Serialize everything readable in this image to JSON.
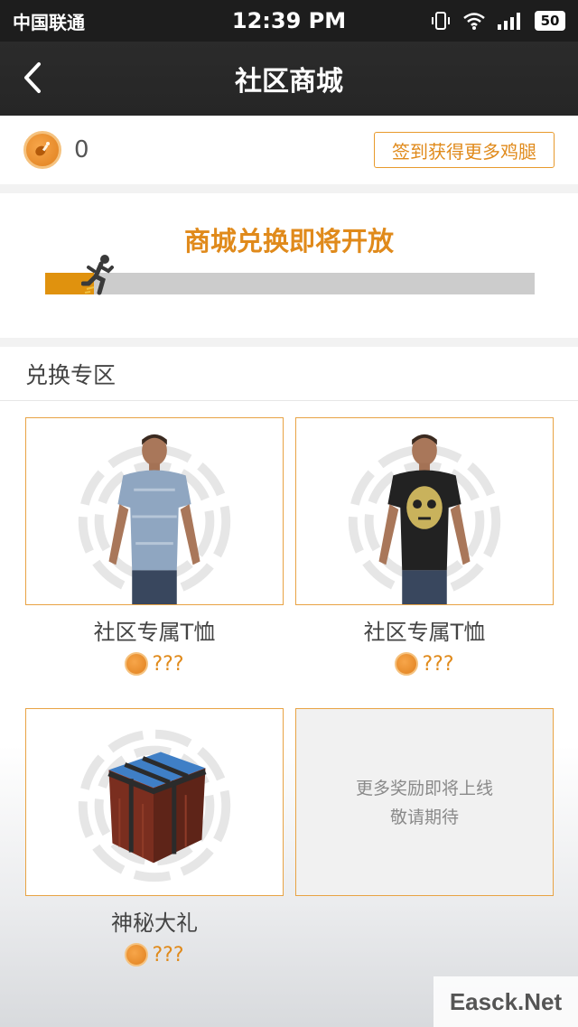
{
  "statusbar": {
    "carrier": "中国联通",
    "time": "12:39 PM",
    "battery": "50",
    "icons": [
      "vibrate-icon",
      "wifi-icon",
      "signal-icon",
      "battery-icon"
    ]
  },
  "navbar": {
    "title": "社区商城",
    "back_icon": "chevron-left-icon"
  },
  "wallet": {
    "coin_icon": "drumstick-coin-icon",
    "balance": "0",
    "signin_button": "签到获得更多鸡腿"
  },
  "progress": {
    "title": "商城兑换即将开放",
    "fraction": 0.1
  },
  "exchange": {
    "header": "兑换专区",
    "items": [
      {
        "name": "社区专属T恤",
        "price": "???",
        "image": "blue-tshirt-character"
      },
      {
        "name": "社区专属T恤",
        "price": "???",
        "image": "black-tshirt-character"
      },
      {
        "name": "神秘大礼",
        "price": "???",
        "image": "airdrop-crate"
      }
    ],
    "placeholder": {
      "line1": "更多奖励即将上线",
      "line2": "敬请期待"
    }
  },
  "watermark": "Easck.Net",
  "colors": {
    "accent": "#e08a1b",
    "card_border": "#e8a344",
    "navbar": "#262626"
  }
}
